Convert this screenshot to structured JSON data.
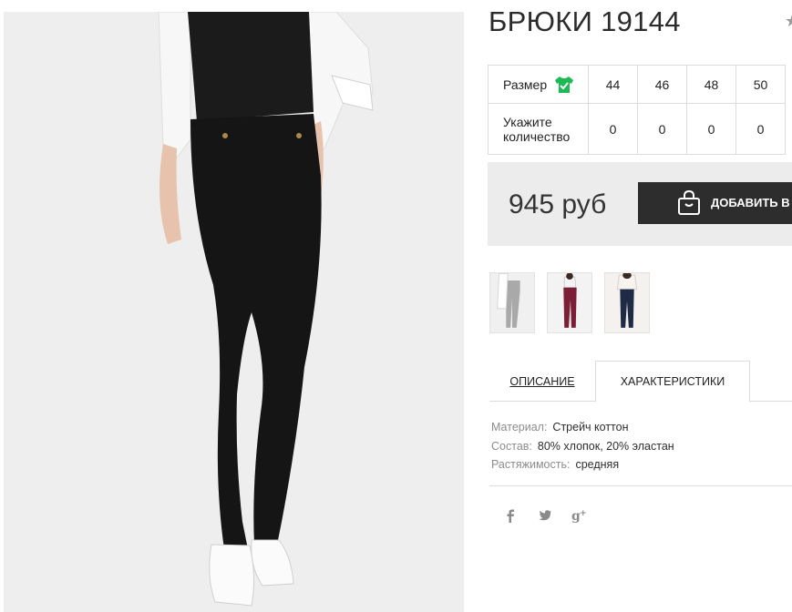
{
  "product": {
    "title": "БРЮКИ 19144",
    "favorite_icon": "star-icon"
  },
  "size_table": {
    "size_label": "Размер",
    "size_icon": "green-shirt-check-icon",
    "quantity_label": "Укажите количество",
    "sizes": [
      "44",
      "46",
      "48",
      "50"
    ],
    "quantities": [
      "0",
      "0",
      "0",
      "0"
    ]
  },
  "buy": {
    "price": "945 руб",
    "cart_button_label": "ДОБАВИТЬ В З",
    "cart_icon": "shopping-bag-icon"
  },
  "thumbnails": [
    {
      "name": "thumb-grey-pants",
      "color": "#a9a9a9"
    },
    {
      "name": "thumb-burgundy-pants",
      "color": "#7a1f35"
    },
    {
      "name": "thumb-navy-pants",
      "color": "#1f2a44"
    }
  ],
  "tabs": [
    {
      "label": "ОПИСАНИЕ",
      "active": false
    },
    {
      "label": "ХАРАКТЕРИСТИКИ",
      "active": true
    }
  ],
  "specs": [
    {
      "key": "Материал:",
      "value": "Стрейч коттон"
    },
    {
      "key": "Состав:",
      "value": "80% хлопок, 20% эластан"
    },
    {
      "key": "Растяжимость:",
      "value": "средняя"
    }
  ],
  "social": [
    {
      "icon": "facebook-icon"
    },
    {
      "icon": "twitter-icon"
    },
    {
      "icon": "google-plus-icon"
    }
  ],
  "colors": {
    "accent_green": "#1db954",
    "button_dark": "#2d2d2d",
    "panel_grey": "#ececec",
    "border": "#dcdcdc"
  }
}
